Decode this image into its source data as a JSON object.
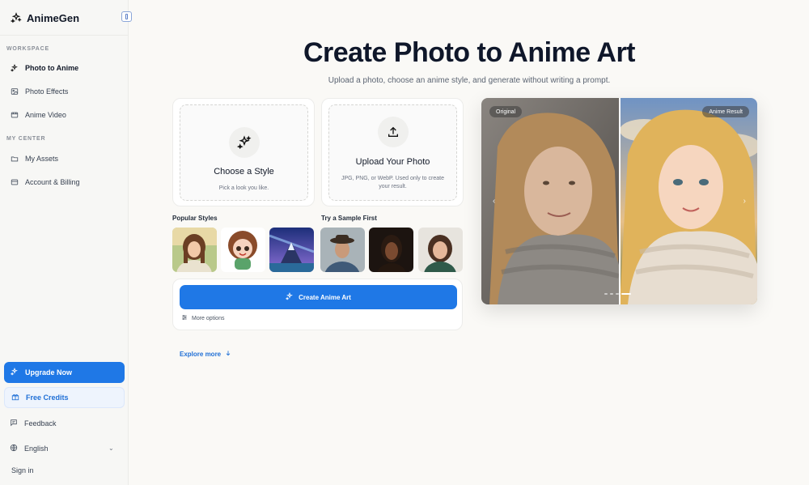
{
  "app": {
    "name": "AnimeGen"
  },
  "sidebar": {
    "workspace_label": "WORKSPACE",
    "workspace_items": [
      {
        "label": "Photo to Anime",
        "icon": "sparkle-icon",
        "active": true
      },
      {
        "label": "Photo Effects",
        "icon": "image-icon"
      },
      {
        "label": "Anime Video",
        "icon": "video-icon"
      }
    ],
    "center_label": "MY CENTER",
    "center_items": [
      {
        "label": "My Assets",
        "icon": "folder-icon"
      },
      {
        "label": "Account & Billing",
        "icon": "card-icon"
      }
    ],
    "upgrade_label": "Upgrade Now",
    "free_credits_label": "Free Credits",
    "feedback_label": "Feedback",
    "language_label": "English",
    "signin_label": "Sign in"
  },
  "hero": {
    "title": "Create Photo to Anime Art",
    "subtitle": "Upload a photo, choose an anime style, and generate without writing a prompt."
  },
  "style_card": {
    "title": "Choose a Style",
    "subtitle": "Pick a look you like."
  },
  "upload_card": {
    "title": "Upload Your Photo",
    "subtitle": "JPG, PNG, or WebP. Used only to create your result."
  },
  "popular_styles_label": "Popular Styles",
  "sample_label": "Try a Sample First",
  "create_button_label": "Create Anime Art",
  "more_options_label": "More options",
  "explore_label": "Explore more",
  "compare": {
    "left_badge": "Original",
    "right_badge": "Anime Result"
  },
  "colors": {
    "accent": "#1f78e6",
    "accent_light": "#eef4fd"
  }
}
